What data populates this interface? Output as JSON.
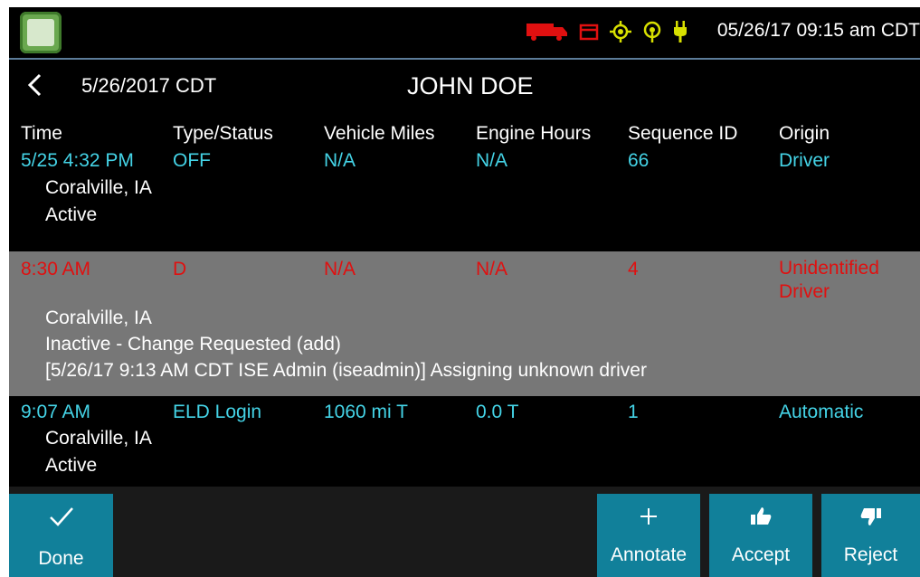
{
  "status_bar": {
    "datetime": "05/26/17 09:15 am CDT",
    "icons": [
      "truck-icon",
      "trailer-icon",
      "gps-icon",
      "signal-icon",
      "plug-icon"
    ],
    "colors": {
      "truck": "#e01010",
      "gps": "#d8e000",
      "signal": "#d8e000",
      "plug": "#d8e000",
      "trailer": "#e01010"
    }
  },
  "header": {
    "date": "5/26/2017 CDT",
    "name": "JOHN DOE"
  },
  "table": {
    "columns": [
      "Time",
      "Type/Status",
      "Vehicle Miles",
      "Engine Hours",
      "Sequence ID",
      "Origin"
    ],
    "rows": [
      {
        "time": "5/25 4:32 PM",
        "type": "OFF",
        "miles": "N/A",
        "hours": "N/A",
        "seq": "66",
        "origin": "Driver",
        "location": "Coralville, IA",
        "status": "Active"
      },
      {
        "time": "8:30 AM",
        "type": "D",
        "miles": "N/A",
        "hours": "N/A",
        "seq": "4",
        "origin_line1": "Unidentified",
        "origin_line2": "Driver",
        "location": "Coralville, IA",
        "status": "Inactive - Change Requested (add)",
        "note": "[5/26/17 9:13 AM CDT ISE Admin (iseadmin)] Assigning unknown driver"
      },
      {
        "time": "9:07 AM",
        "type": "ELD Login",
        "miles": "1060 mi T",
        "hours": "0.0 T",
        "seq": "1",
        "origin": "Automatic",
        "location": "Coralville, IA",
        "status": "Active"
      }
    ]
  },
  "bottom": {
    "done": "Done",
    "annotate": "Annotate",
    "accept": "Accept",
    "reject": "Reject"
  },
  "colors": {
    "accent": "#11809a",
    "highlight_row": "#777777",
    "cyan_text": "#44d3e6",
    "red_text": "#e01010"
  }
}
